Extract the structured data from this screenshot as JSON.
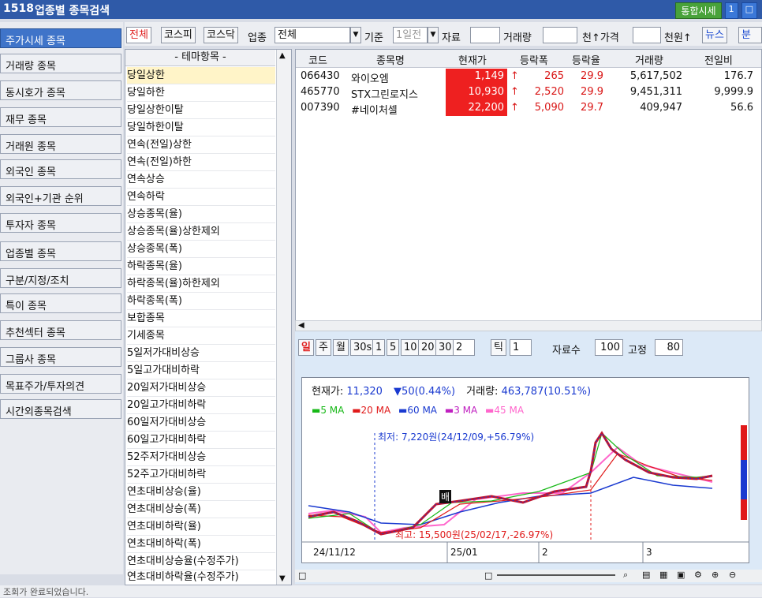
{
  "titlebar": {
    "screen_no": "1518",
    "title": "업종별 종목검색",
    "integrated_quote": "통합시세",
    "mini1": "1",
    "mini2": "□"
  },
  "sidebar": {
    "items": [
      "주가시세 종목",
      "거래량 종목",
      "동시호가 종목",
      "재무 종목",
      "거래원 종목",
      "외국인 종목",
      "외국인+기관 순위",
      "투자자 종목",
      "업종별 종목",
      "구분/지정/조치",
      "특이 종목",
      "추천섹터 종목",
      "그룹사 종목",
      "목표주가/투자의견",
      "시간외종목검색"
    ]
  },
  "toolbar": {
    "market_tabs": [
      "전체",
      "코스피",
      "코스닥"
    ],
    "industry_label": "업종",
    "industry_value": "전체",
    "basis_label": "기준",
    "basis_value": "1일전",
    "data_label": "자료",
    "volume_label": "거래량",
    "price_unit_label": "천↑가격",
    "price_unit2_label": "천원↑",
    "news_button": "뉴스",
    "extra_button": "분"
  },
  "theme_list": {
    "header": "- 테마항목 -",
    "items": [
      "당일상한",
      "당일하한",
      "당일상한이탈",
      "당일하한이탈",
      "연속(전일)상한",
      "연속(전일)하한",
      "연속상승",
      "연속하락",
      "상승종목(율)",
      "상승종목(율)상한제외",
      "상승종목(폭)",
      "하락종목(율)",
      "하락종목(율)하한제외",
      "하락종목(폭)",
      "보합종목",
      "기세종목",
      "5일저가대비상승",
      "5일고가대비하락",
      "20일저가대비상승",
      "20일고가대비하락",
      "60일저가대비상승",
      "60일고가대비하락",
      "52주저가대비상승",
      "52주고가대비하락",
      "연초대비상승(율)",
      "연초대비상승(폭)",
      "연초대비하락(율)",
      "연초대비하락(폭)",
      "연초대비상승율(수정주가)",
      "연초대비하락율(수정주가)"
    ]
  },
  "grid": {
    "columns": [
      "코드",
      "종목명",
      "현재가",
      "등락폭",
      "등락율",
      "거래량",
      "전일비"
    ],
    "rows": [
      {
        "code": "066430",
        "name": "와이오엠",
        "price": "1,149",
        "change": "265",
        "rate": "29.9",
        "volume": "5,617,502",
        "prev": "176.7"
      },
      {
        "code": "465770",
        "name": "STX그린로지스",
        "price": "10,930",
        "change": "2,520",
        "rate": "29.9",
        "volume": "9,451,311",
        "prev": "9,999.9"
      },
      {
        "code": "007390",
        "name": "#네이처셀",
        "price": "22,200",
        "change": "5,090",
        "rate": "29.7",
        "volume": "409,947",
        "prev": "56.6"
      }
    ],
    "up_symbol": "↑"
  },
  "chart_toolbar": {
    "periods": [
      "일",
      "주",
      "월",
      "30s",
      "1",
      "5",
      "10",
      "20",
      "30"
    ],
    "custom_value": "2",
    "tick_label": "틱",
    "tick_value": "1",
    "data_count_label": "자료수",
    "data_count_value": "100",
    "fixed_label": "고정",
    "fixed_value": "80"
  },
  "chart_info": {
    "current_label": "현재가:",
    "current_value": "11,320",
    "change_text": "▼50(0.44%)",
    "volume_label": "거래량:",
    "volume_value": "463,787(10.51%)",
    "ma_legend": [
      "5 MA",
      "20 MA",
      "60 MA",
      "3 MA",
      "45 MA"
    ],
    "ma_colors": [
      "#16b816",
      "#e01a1a",
      "#1a3ad0",
      "#c020c0",
      "#ff66cc"
    ],
    "low_annotation": "최저: 7,220원(24/12/09,+56.79%)",
    "high_annotation": "최고: 15,500원(25/02/17,-26.97%)",
    "x_ticks": [
      "24/11/12",
      "25/01",
      "2",
      "3"
    ],
    "marker": "배"
  },
  "status": {
    "text": "조회가 완료되었습니다."
  },
  "colors": {
    "title_bg": "#2f5aa8",
    "active_sidebar": "#3f74c9",
    "up_red": "#ee2020",
    "highlight": "#fff4c8"
  }
}
